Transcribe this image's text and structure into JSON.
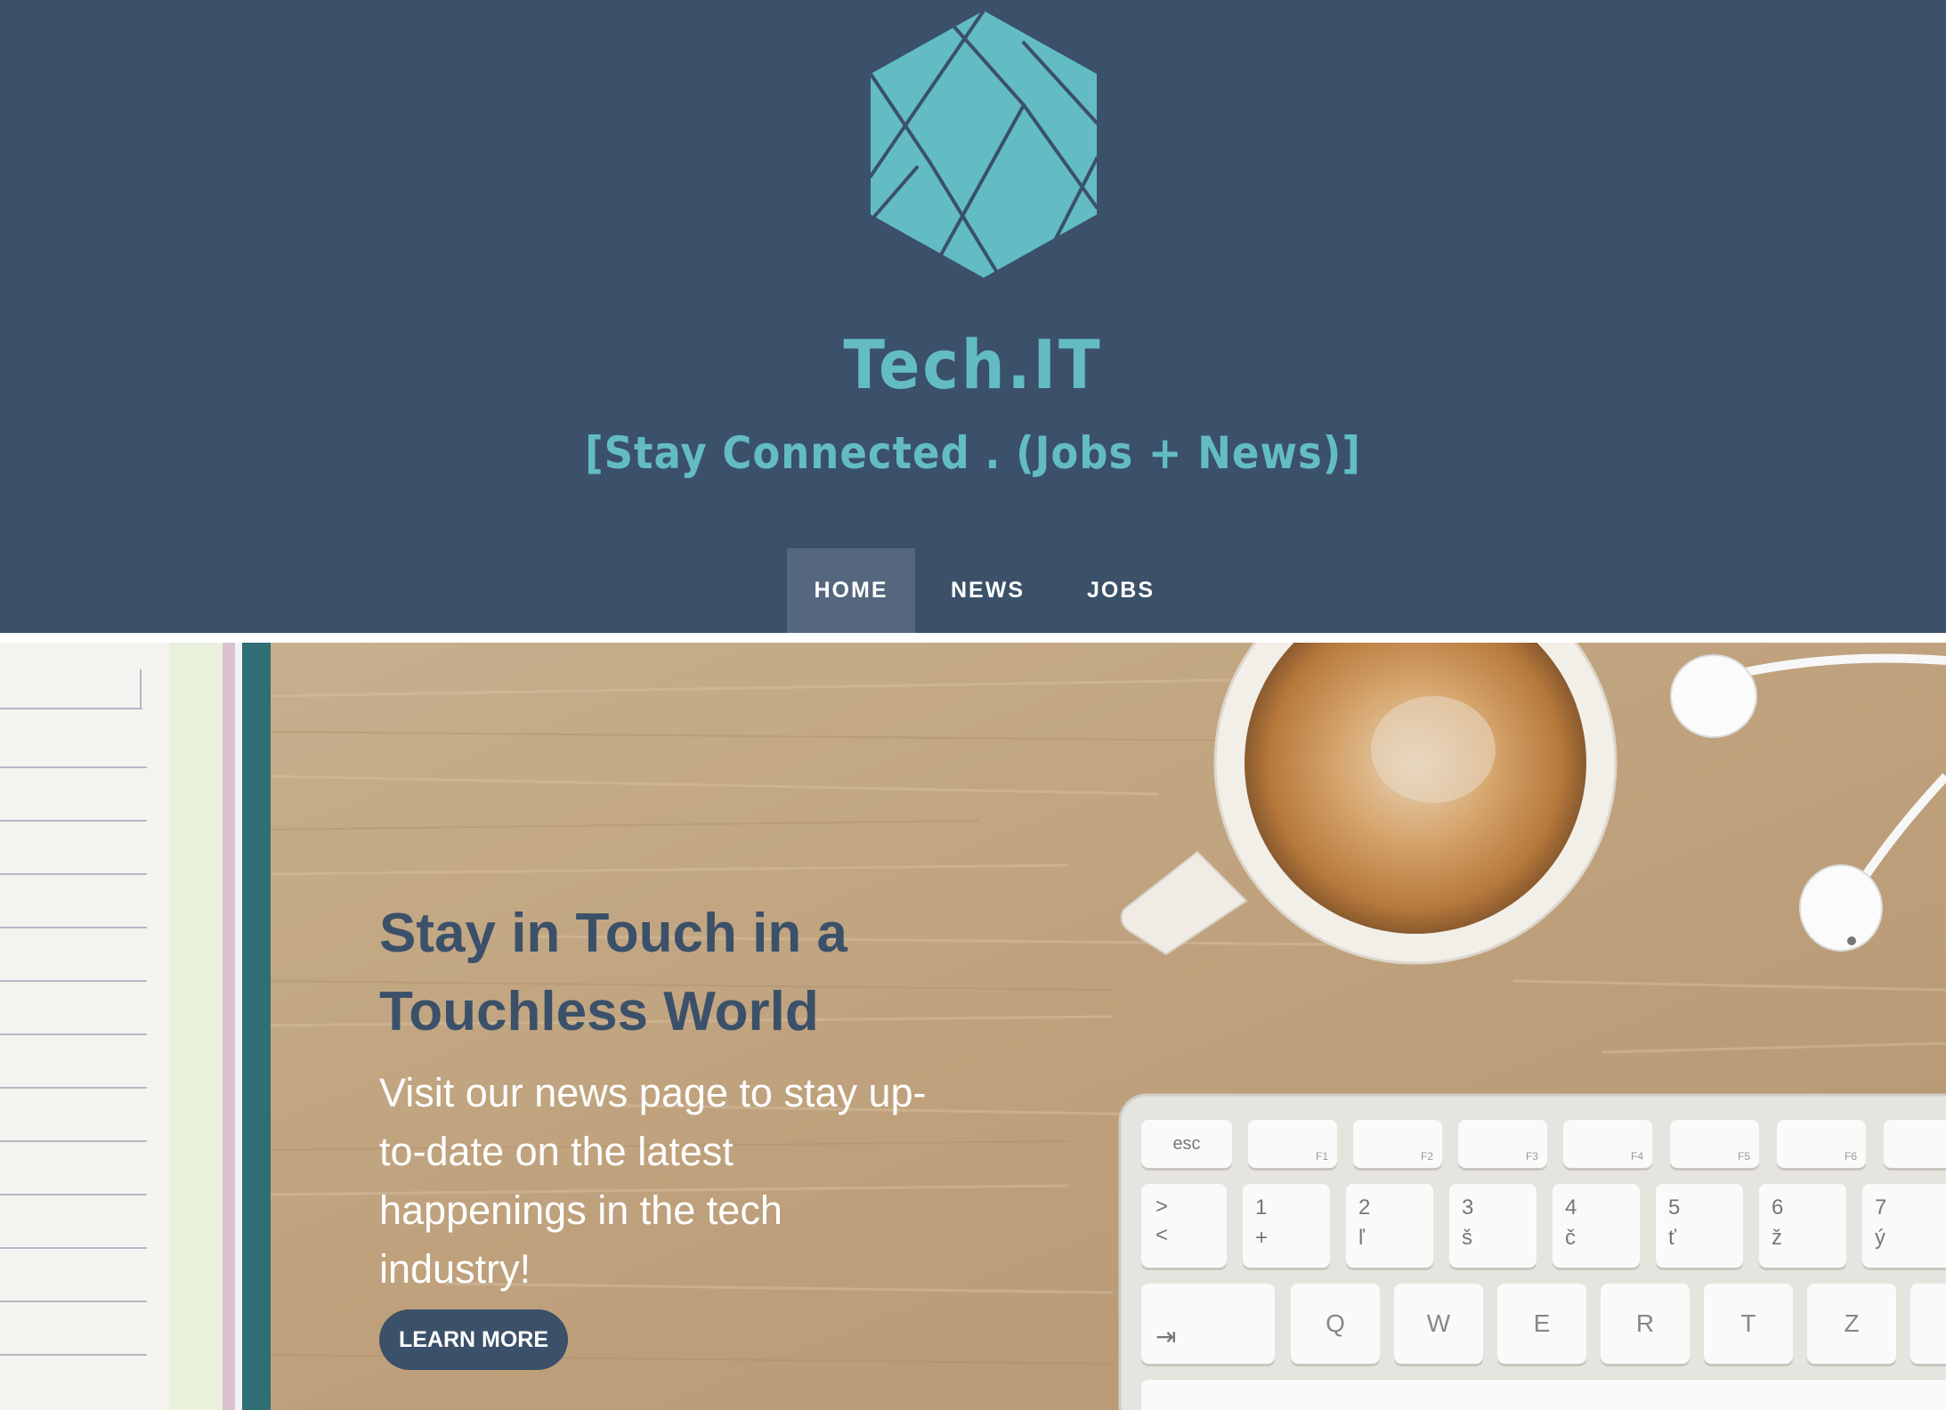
{
  "brand": {
    "logo_icon": "faceted-hexagon-icon",
    "title": "Tech.IT",
    "tagline": "[Stay Connected . (Jobs + News)]"
  },
  "nav": {
    "items": [
      {
        "label": "HOME",
        "active": true
      },
      {
        "label": "NEWS",
        "active": false
      },
      {
        "label": "JOBS",
        "active": false
      }
    ]
  },
  "hero": {
    "heading_line1": "Stay in Touch in a",
    "heading_line2": "Touchless World",
    "text_lines": [
      "Visit our news page to stay up-",
      "to-date on the latest",
      "happenings in the tech",
      "industry!"
    ],
    "button_label": "LEARN MORE",
    "background": "desk-photo-with-notebook-coffee-earbuds-keyboard",
    "keyboard_keys": {
      "row1": [
        "esc",
        "",
        "",
        "",
        "",
        "",
        "",
        ""
      ],
      "row1_fn": [
        "",
        "F1",
        "F2",
        "F3",
        "F4",
        "F5",
        "F6",
        ""
      ],
      "row2_top": [
        ">",
        "1",
        "2",
        "3",
        "4",
        "5",
        "6",
        "7"
      ],
      "row2_bottom": [
        "<",
        "+",
        "ľ",
        "š",
        "č",
        "ť",
        "ž",
        "ý"
      ],
      "row2_right": [
        "",
        "ˇ",
        "@",
        "#",
        "$",
        "~",
        "^",
        "&"
      ],
      "row3": [
        "⇥",
        "Q",
        "W",
        "E",
        "R",
        "T",
        "Z"
      ]
    }
  },
  "colors": {
    "header_bg": "#3b5069",
    "accent_teal": "#63bcc4",
    "nav_active_bg": "#54677f",
    "button_bg": "#3b5069"
  }
}
